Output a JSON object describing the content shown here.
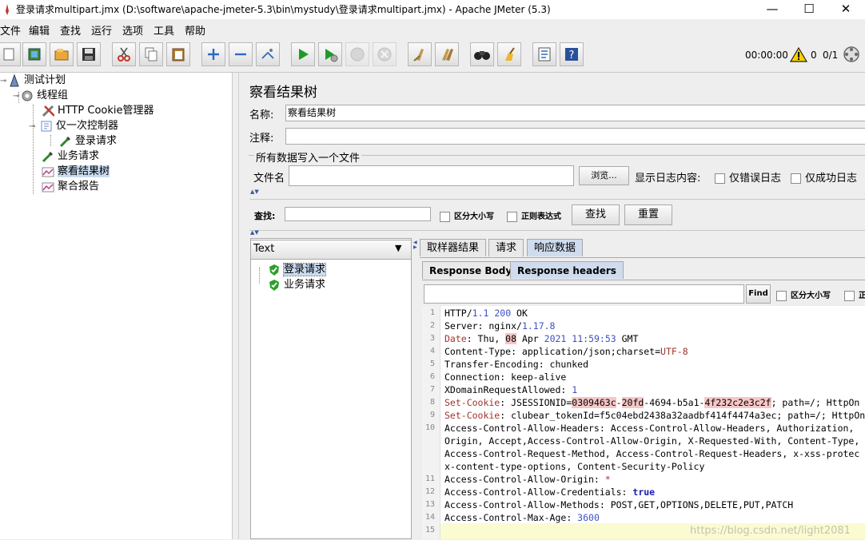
{
  "window": {
    "title": "登录请求multipart.jmx (D:\\software\\apache-jmeter-5.3\\bin\\mystudy\\登录请求multipart.jmx) - Apache JMeter (5.3)",
    "minimize": "—",
    "maximize": "☐",
    "close": "✕"
  },
  "menu": [
    "文件",
    "编辑",
    "查找",
    "运行",
    "选项",
    "工具",
    "帮助"
  ],
  "toolbar": {
    "timer": "00:00:00",
    "warnings": "0",
    "threads": "0/1"
  },
  "tree": {
    "items": [
      {
        "label": "测试计划",
        "icon": "test-plan-icon"
      },
      {
        "label": "线程组",
        "icon": "thread-group-gear-icon"
      },
      {
        "label": "HTTP Cookie管理器",
        "icon": "tools-icon"
      },
      {
        "label": "仅一次控制器",
        "icon": "controller-icon"
      },
      {
        "label": "登录请求",
        "icon": "pipette-icon"
      },
      {
        "label": "业务请求",
        "icon": "pipette-icon"
      },
      {
        "label": "察看结果树",
        "icon": "graph-icon"
      },
      {
        "label": "聚合报告",
        "icon": "graph-icon"
      }
    ]
  },
  "panel": {
    "heading": "察看结果树",
    "name_label": "名称:",
    "name_value": "察看结果树",
    "comment_label": "注释:",
    "comment_value": "",
    "file_section": "所有数据写入一个文件",
    "filename_label": "文件名",
    "filename_value": "",
    "browse_button": "浏览...",
    "show_log_label": "显示日志内容:",
    "errors_only": "仅错误日志",
    "success_only": "仅成功日志"
  },
  "search": {
    "label": "查找:",
    "value": "",
    "case_sensitive": "区分大小写",
    "regex": "正则表达式",
    "find_button": "查找",
    "reset_button": "重置"
  },
  "results": {
    "renderer": "Text",
    "items": [
      "登录请求",
      "业务请求"
    ]
  },
  "detail": {
    "tabs": [
      "取样器结果",
      "请求",
      "响应数据"
    ],
    "subtabs": [
      "Response Body",
      "Response headers"
    ],
    "find_value": "",
    "find_button": "Find",
    "find_case": "区分大小写",
    "find_regex_partial": "正"
  },
  "headers_lines": [
    "1",
    "2",
    "3",
    "4",
    "5",
    "6",
    "7",
    "8",
    "9",
    "10",
    "11",
    "12",
    "13",
    "14",
    "15"
  ],
  "headers_text": {
    "l1": "HTTP/1.1 200 OK",
    "l2": "Server: nginx/1.17.8",
    "l3": "Date: Thu, 08 Apr 2021 11:59:53 GMT",
    "l4": "Content-Type: application/json;charset=UTF-8",
    "l5": "Transfer-Encoding: chunked",
    "l6": "Connection: keep-alive",
    "l7": "XDomainRequestAllowed: 1",
    "l8": "Set-Cookie: JSESSIONID=0309463c-20fd-4694-b5a1-4f232c2e3c2f; path=/; HttpOn",
    "l9": "Set-Cookie: clubear_tokenId=f5c04ebd2438a32aadbf414f4474a3ec; path=/; HttpOn",
    "l10a": "Access-Control-Allow-Headers: Access-Control-Allow-Headers, Authorization,",
    "l10b": "Origin, Accept,Access-Control-Allow-Origin, X-Requested-With, Content-Type,",
    "l10c": "Access-Control-Request-Method, Access-Control-Request-Headers, x-xss-protec",
    "l10d": "x-content-type-options, Content-Security-Policy",
    "l11": "Access-Control-Allow-Origin: *",
    "l12": "Access-Control-Allow-Credentials: true",
    "l13": "Access-Control-Allow-Methods: POST,GET,OPTIONS,DELETE,PUT,PATCH",
    "l14": "Access-Control-Max-Age: 3600",
    "l15": ""
  },
  "watermark": "https://blog.csdn.net/light2081"
}
